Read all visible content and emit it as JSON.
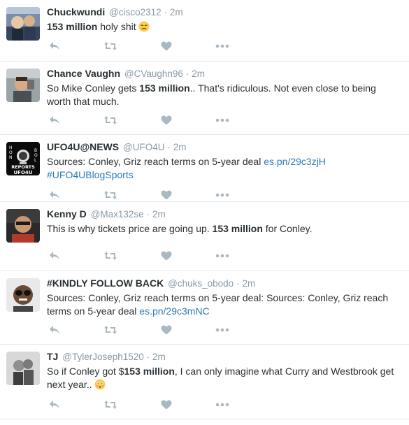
{
  "colors": {
    "text": "#292f33",
    "muted": "#8899a6",
    "link": "#2b7bb9",
    "icon": "#aab8c2",
    "divider": "#e1e8ed"
  },
  "tweets": [
    {
      "name": "Chuckwundi",
      "handle": "@cisco2312",
      "dot": "·",
      "time": "2m",
      "segments": [
        {
          "t": "153 million",
          "b": true
        },
        {
          "t": " holy shit",
          "b": false
        }
      ],
      "emoji": "sad-face-emoji"
    },
    {
      "name": "Chance Vaughn",
      "handle": "@CVaughn96",
      "dot": "·",
      "time": "2m",
      "segments": [
        {
          "t": "So Mike Conley gets ",
          "b": false
        },
        {
          "t": "153 million",
          "b": true
        },
        {
          "t": ".. That's ridiculous. Not even close to being worth that much.",
          "b": false
        }
      ]
    },
    {
      "name": "UFO4U@NEWS",
      "handle": "@UFO4U",
      "dot": "·",
      "time": "2m",
      "segments": [
        {
          "t": "Sources: Conley, Griz reach terms on 5-year deal ",
          "b": false
        },
        {
          "t": "es.pn/29c3zjH",
          "link": true
        },
        {
          "t": " ",
          "b": false
        },
        {
          "t": "#UFO4UBlogSports",
          "link": true
        }
      ]
    },
    {
      "name": "Kenny D",
      "handle": "@Max132se",
      "dot": "·",
      "time": "2m",
      "segments": [
        {
          "t": "This is why tickets price are going up.  ",
          "b": false
        },
        {
          "t": "153 million",
          "b": true
        },
        {
          "t": " for Conley.",
          "b": false
        }
      ]
    },
    {
      "name": "#KINDLY FOLLOW BACK",
      "handle": "@chuks_obodo",
      "dot": "·",
      "time": "2m",
      "segments": [
        {
          "t": "Sources: Conley, Griz reach terms on 5-year deal: Sources: Conley, Griz reach terms on 5-year deal ",
          "b": false
        },
        {
          "t": "es.pn/29c3mNC",
          "link": true
        }
      ]
    },
    {
      "name": "TJ",
      "handle": "@TylerJoseph1520",
      "dot": "·",
      "time": "2m",
      "segments": [
        {
          "t": "So if Conley got $",
          "b": false
        },
        {
          "t": "153 million",
          "b": true
        },
        {
          "t": ", I can only imagine what Curry and Westbrook get next year..",
          "b": false
        }
      ],
      "emoji": "flushed-face-emoji"
    }
  ],
  "ufo_avatar_text": {
    "left": "HONEST",
    "center": "REPORTS",
    "bottom": "UFO4U",
    "right": "BOLD"
  },
  "icons": {
    "reply": "reply-icon",
    "retweet": "retweet-icon",
    "like": "heart-icon",
    "more": "more-icon"
  }
}
